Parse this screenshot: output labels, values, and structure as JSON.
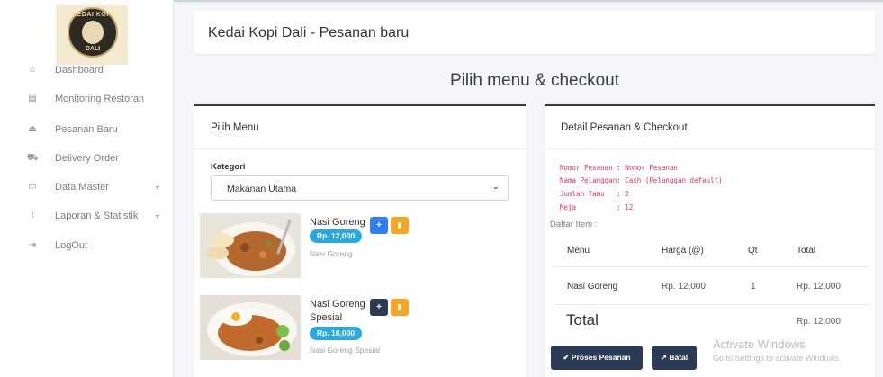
{
  "logo": {
    "top_text": "KEDAI KOPI",
    "bottom_text": "DALI"
  },
  "sidebar": {
    "items": [
      {
        "label": "Dashboard",
        "icon": "home-icon",
        "glyph": "⌂"
      },
      {
        "label": "Monitoring Restoran",
        "icon": "monitor-icon",
        "glyph": "▤"
      },
      {
        "label": "Pesanan Baru",
        "icon": "eject-icon",
        "glyph": "⏏"
      },
      {
        "label": "Delivery Order",
        "icon": "truck-icon",
        "glyph": "⛟"
      },
      {
        "label": "Data Master",
        "icon": "database-icon",
        "glyph": "▭",
        "caret": "▾"
      },
      {
        "label": "Laporan & Statistik",
        "icon": "chart-icon",
        "glyph": "⌇",
        "caret": "▾"
      },
      {
        "label": "LogOut",
        "icon": "logout-icon",
        "glyph": "⇥"
      }
    ]
  },
  "header": {
    "title": "Kedai Kopi Dali - Pesanan baru"
  },
  "page": {
    "title": "Pilih menu & checkout"
  },
  "menu_card": {
    "title": "Pilih Menu",
    "kategori_label": "Kategori",
    "kategori_value": "Makanan Utama",
    "items": [
      {
        "name": "Nasi Goreng",
        "price": "Rp. 12,000",
        "desc": "Nasi Goreng"
      },
      {
        "name": "Nasi Goreng Spesial",
        "price": "Rp. 18,000",
        "desc": "Nasi Goreng Spesial"
      }
    ]
  },
  "detail_card": {
    "title": "Detail Pesanan & Checkout",
    "info": [
      "Nomor Pesanan : Nomor Pesanan",
      "Nama Pelanggan: Cash (Pelanggan default)",
      "Jumlah Tamu   : 2",
      "Meja          : 12"
    ],
    "daftar_label": "Daftar Item :",
    "columns": [
      "Menu",
      "Harga (@)",
      "Qt",
      "Total"
    ],
    "rows": [
      [
        "Nasi Goreng",
        "Rp. 12,000",
        "1",
        "Rp. 12,000"
      ]
    ],
    "total_label": "Total",
    "total_value": "Rp. 12,000",
    "proses_label": "Proses Pesanan",
    "batal_label": "Batal"
  },
  "watermark": {
    "line1": "Activate Windows",
    "line2": "Go to Settings to activate Windows."
  },
  "colors": {
    "accent": "#29a9e1",
    "primary_button": "#2b3a55",
    "warning": "#f5a623",
    "pink_text": "#d6336c"
  }
}
